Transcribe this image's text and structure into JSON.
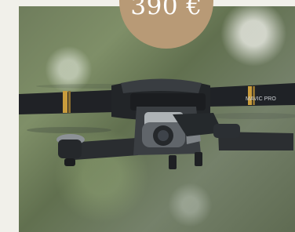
{
  "product": {
    "price": "390 €",
    "drone_model_label": "MAVIC PRO"
  }
}
